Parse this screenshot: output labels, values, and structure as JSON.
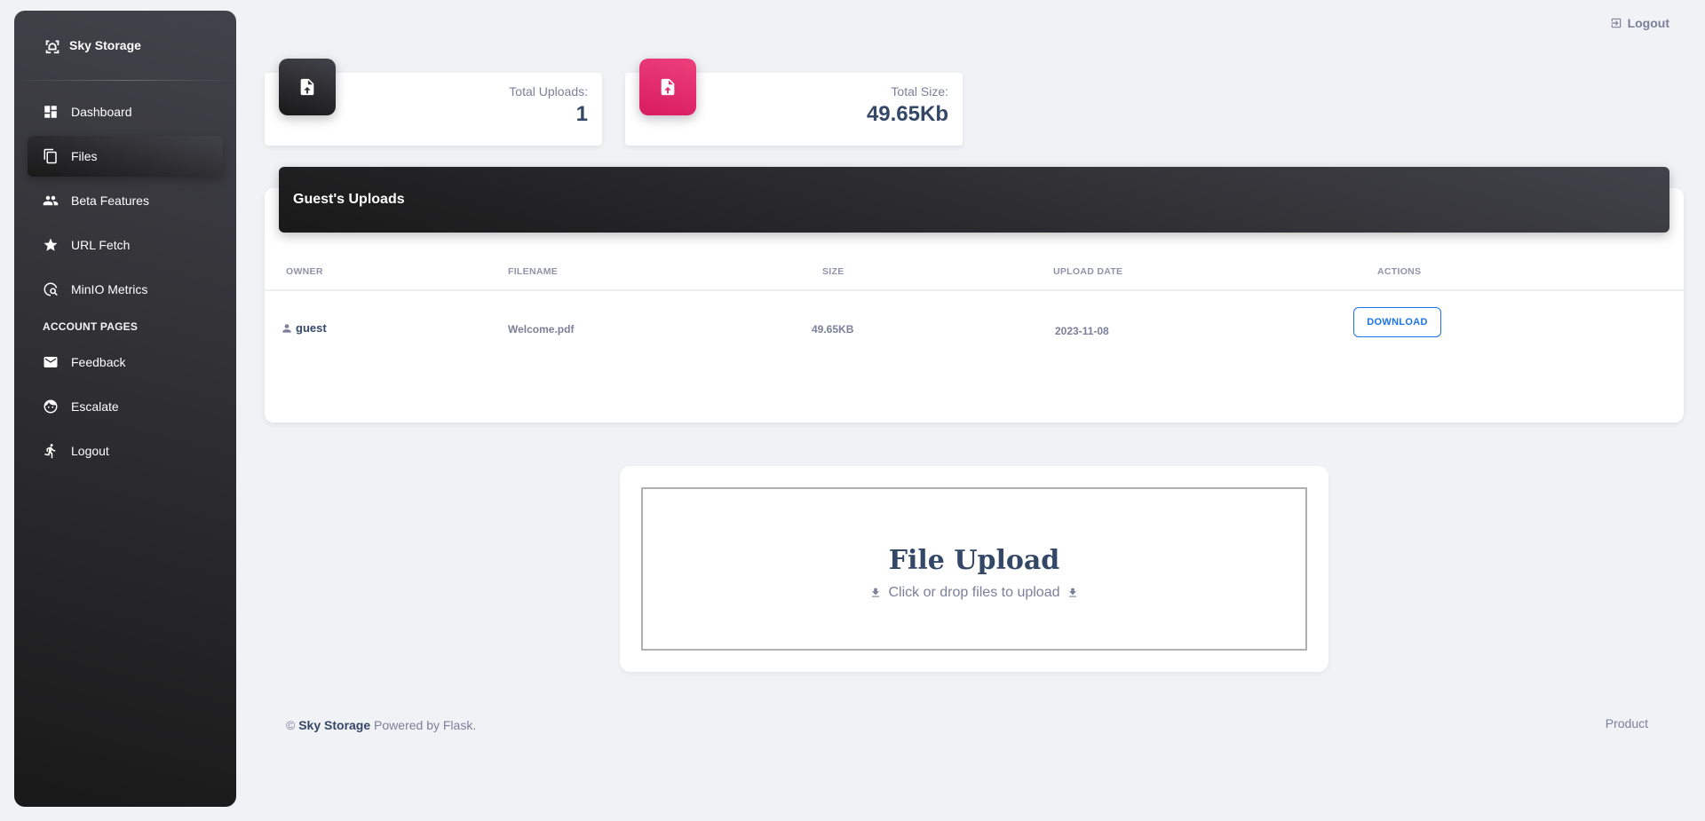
{
  "sidebar": {
    "brand": "Sky Storage",
    "items": [
      {
        "label": "Dashboard",
        "icon": "dashboard-icon"
      },
      {
        "label": "Files",
        "icon": "files-icon",
        "active": true
      },
      {
        "label": "Beta Features",
        "icon": "people-icon"
      },
      {
        "label": "URL Fetch",
        "icon": "star-icon"
      },
      {
        "label": "MinIO Metrics",
        "icon": "metrics-search-icon"
      }
    ],
    "section_title": "ACCOUNT PAGES",
    "account_items": [
      {
        "label": "Feedback",
        "icon": "mail-icon"
      },
      {
        "label": "Escalate",
        "icon": "face-icon"
      },
      {
        "label": "Logout",
        "icon": "run-icon"
      }
    ]
  },
  "topbar": {
    "logout_label": "Logout"
  },
  "stats": {
    "uploads": {
      "label": "Total Uploads:",
      "value": "1"
    },
    "size": {
      "label": "Total Size:",
      "value": "49.65Kb"
    }
  },
  "uploads": {
    "title": "Guest's Uploads",
    "columns": [
      "OWNER",
      "FILENAME",
      "SIZE",
      "UPLOAD DATE",
      "ACTIONS"
    ],
    "rows": [
      {
        "owner": "guest",
        "filename": "Welcome.pdf",
        "size": "49.65KB",
        "date": "2023-11-08",
        "action": "DOWNLOAD"
      }
    ]
  },
  "upload_box": {
    "title": "File Upload",
    "subtitle": "Click or drop files to upload"
  },
  "footer": {
    "copyright": "©",
    "brand": "Sky Storage",
    "powered": "Powered by Flask.",
    "product_link": "Product"
  },
  "colors": {
    "accent_blue": "#1a73e8",
    "pink": "#e91e63",
    "dark": "#191919",
    "text": "#344767",
    "muted": "#7b809a"
  }
}
